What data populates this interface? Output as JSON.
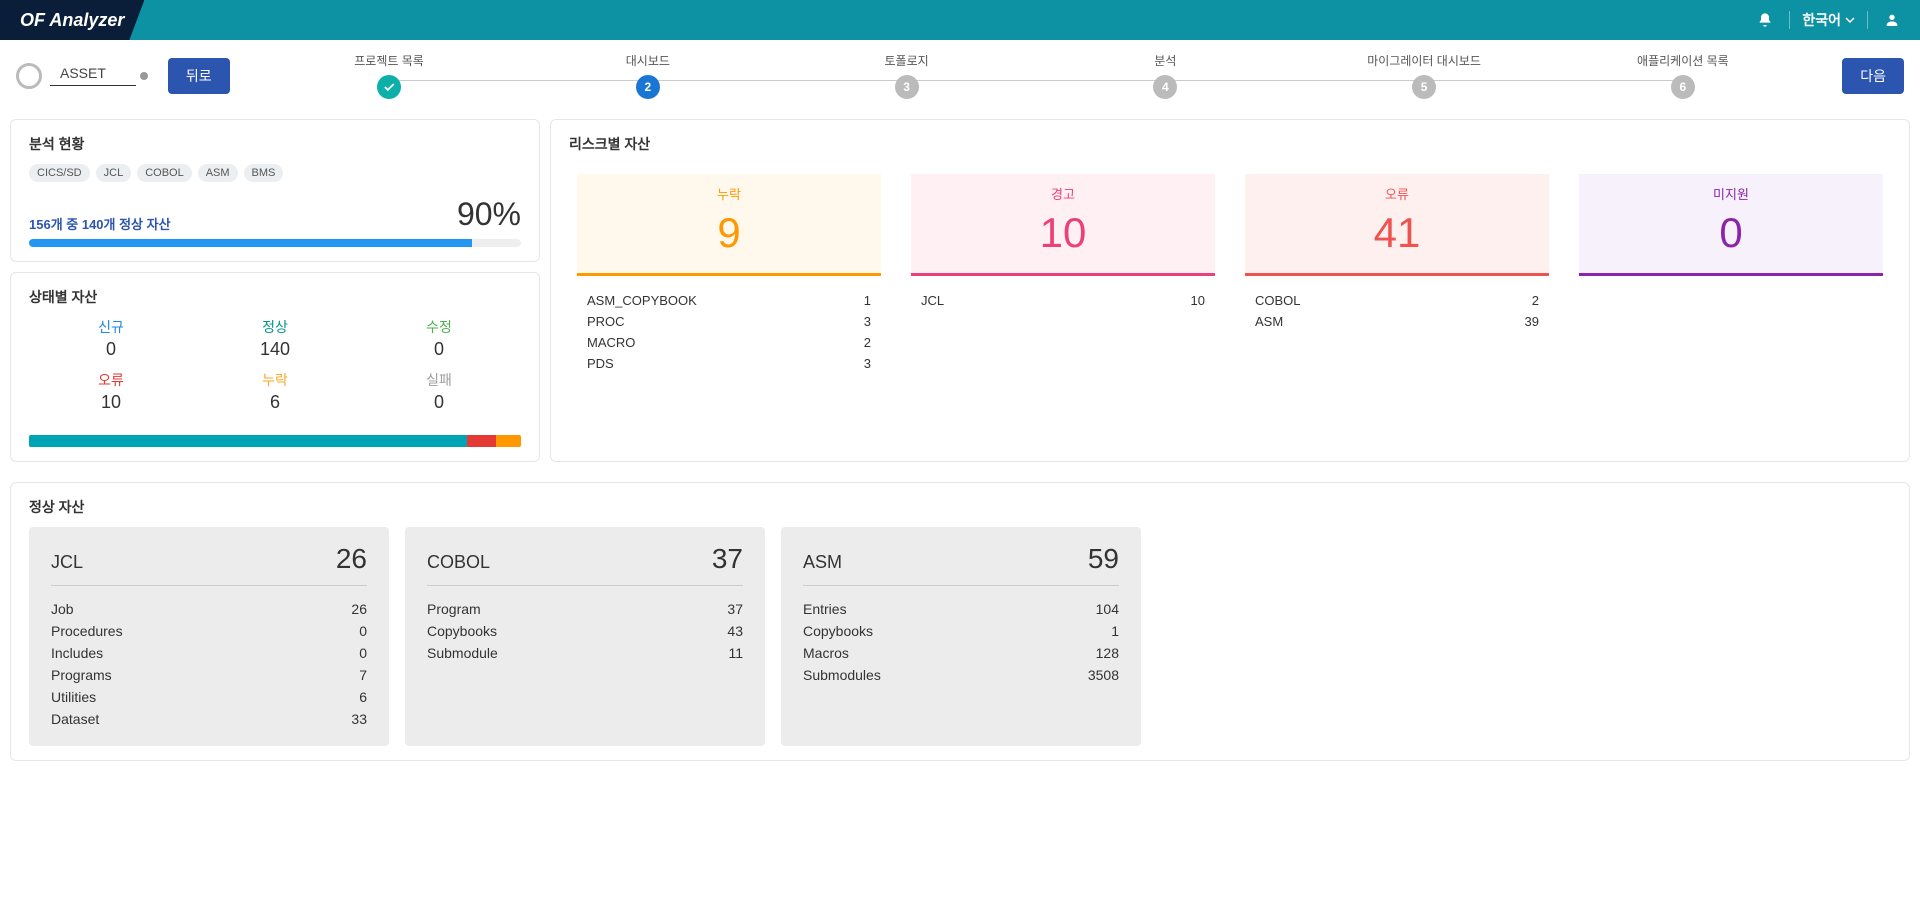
{
  "header": {
    "brand": "OF Analyzer",
    "language": "한국어"
  },
  "nav": {
    "asset": "ASSET",
    "back": "뒤로",
    "next": "다음"
  },
  "steps": [
    {
      "label": "프로젝트 목록",
      "state": "done",
      "num": ""
    },
    {
      "label": "대시보드",
      "state": "active",
      "num": "2"
    },
    {
      "label": "토폴로지",
      "state": "pending",
      "num": "3"
    },
    {
      "label": "분석",
      "state": "pending",
      "num": "4"
    },
    {
      "label": "마이그레이터 대시보드",
      "state": "pending",
      "num": "5"
    },
    {
      "label": "애플리케이션 목록",
      "state": "pending",
      "num": "6"
    }
  ],
  "analysis": {
    "title": "분석 현황",
    "chips": [
      "CICS/SD",
      "JCL",
      "COBOL",
      "ASM",
      "BMS"
    ],
    "normal_text": "156개 중 140개 정상 자산",
    "percent": "90%"
  },
  "state": {
    "title": "상태별 자산",
    "items": [
      {
        "label": "신규",
        "value": "0",
        "cls": "c-new"
      },
      {
        "label": "정상",
        "value": "140",
        "cls": "c-ok"
      },
      {
        "label": "수정",
        "value": "0",
        "cls": "c-mod"
      },
      {
        "label": "오류",
        "value": "10",
        "cls": "c-err"
      },
      {
        "label": "누락",
        "value": "6",
        "cls": "c-miss"
      },
      {
        "label": "실패",
        "value": "0",
        "cls": "c-fail"
      }
    ],
    "segments": [
      {
        "color": "#00a4b7",
        "pct": 89
      },
      {
        "color": "#e53935",
        "pct": 6
      },
      {
        "color": "#ff9800",
        "pct": 5
      }
    ]
  },
  "risk": {
    "title": "리스크별 자산",
    "cards": [
      {
        "cls": "risk-miss",
        "title": "누락",
        "num": "9",
        "rows": [
          [
            "ASM_COPYBOOK",
            "1"
          ],
          [
            "PROC",
            "3"
          ],
          [
            "MACRO",
            "2"
          ],
          [
            "PDS",
            "3"
          ]
        ]
      },
      {
        "cls": "risk-warn",
        "title": "경고",
        "num": "10",
        "rows": [
          [
            "JCL",
            "10"
          ]
        ]
      },
      {
        "cls": "risk-err",
        "title": "오류",
        "num": "41",
        "rows": [
          [
            "COBOL",
            "2"
          ],
          [
            "ASM",
            "39"
          ]
        ]
      },
      {
        "cls": "risk-un",
        "title": "미지원",
        "num": "0",
        "rows": []
      }
    ]
  },
  "sound": {
    "title": "정상 자산",
    "cards": [
      {
        "title": "JCL",
        "total": "26",
        "rows": [
          [
            "Job",
            "26"
          ],
          [
            "Procedures",
            "0"
          ],
          [
            "Includes",
            "0"
          ],
          [
            "Programs",
            "7"
          ],
          [
            "Utilities",
            "6"
          ],
          [
            "Dataset",
            "33"
          ]
        ]
      },
      {
        "title": "COBOL",
        "total": "37",
        "rows": [
          [
            "Program",
            "37"
          ],
          [
            "Copybooks",
            "43"
          ],
          [
            "Submodule",
            "11"
          ]
        ]
      },
      {
        "title": "ASM",
        "total": "59",
        "rows": [
          [
            "Entries",
            "104"
          ],
          [
            "Copybooks",
            "1"
          ],
          [
            "Macros",
            "128"
          ],
          [
            "Submodules",
            "3508"
          ]
        ]
      }
    ]
  }
}
